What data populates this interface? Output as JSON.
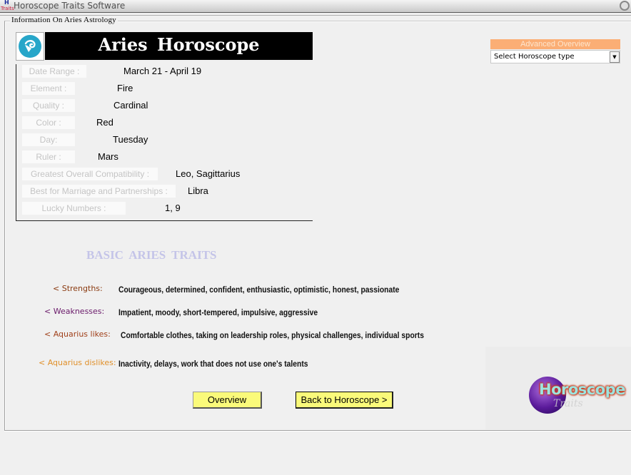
{
  "window": {
    "title": "Horoscope Traits Software",
    "icon_top": "H",
    "icon_bottom": "Traits"
  },
  "groupbox": {
    "legend": "Information On Aries Astrology"
  },
  "header": {
    "sign_icon": "aries-ram-icon",
    "title": "Aries  Horoscope"
  },
  "info": {
    "rows": [
      {
        "label": "Date Range :",
        "value": "March 21 - April 19"
      },
      {
        "label": "Element :",
        "value": "Fire"
      },
      {
        "label": "Quality :",
        "value": "Cardinal"
      },
      {
        "label": "Color :",
        "value": "Red"
      },
      {
        "label": "Day:",
        "value": "Tuesday"
      },
      {
        "label": "Ruler :",
        "value": "Mars"
      },
      {
        "label": "Greatest Overall Compatibility :",
        "value": "Leo, Sagittarius"
      },
      {
        "label": "Best for Marriage and Partnerships :",
        "value": "Libra"
      },
      {
        "label": "Lucky Numbers :",
        "value": "1, 9"
      }
    ]
  },
  "advanced": {
    "header": "Advanced Overview",
    "select_value": "Select  Horoscope type",
    "arrow_icon": "chevron-down-icon"
  },
  "traits": {
    "heading": "BASIC ARIES  TRAITS",
    "items": [
      {
        "label": "< Strengths:",
        "value": "Courageous, determined, confident, enthusiastic, optimistic, honest, passionate",
        "color": "#8a3a10"
      },
      {
        "label": "< Weaknesses:",
        "value": "Impatient, moody, short-tempered, impulsive, aggressive",
        "color": "#6a1a6a"
      },
      {
        "label": "< Aquarius likes:",
        "value": "Comfortable clothes, taking on leadership roles, physical challenges, individual sports",
        "color": "#a0401a"
      },
      {
        "label": "< Aquarius dislikes:",
        "value": "Inactivity, delays, work that does not use one's talents",
        "color": "#e0902a"
      }
    ]
  },
  "buttons": {
    "overview": "Overview",
    "back": "Back to Horoscope >"
  },
  "logo": {
    "title": "Horoscope",
    "subtitle": "Traits"
  },
  "colors": {
    "banner_bg": "#000000",
    "button_bg": "#fafa7a",
    "dropdown_header_bg": "#fbae75",
    "sign_icon_bg": "#27a6c9"
  }
}
